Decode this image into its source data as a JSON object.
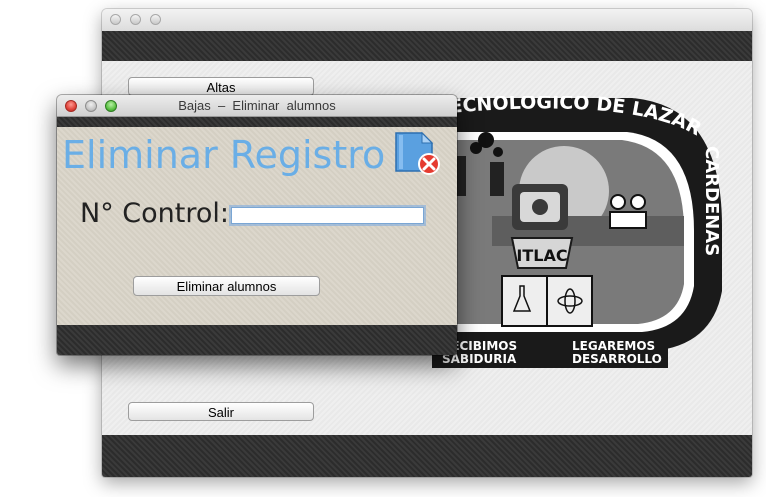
{
  "main_window": {
    "buttons": {
      "altas": "Altas",
      "salir": "Salir"
    }
  },
  "logo": {
    "top_text": "TECNOLOGICO DE LAZARO",
    "side_text": "CARDENAS",
    "center_badge": "ITLAC",
    "motto_left_1": "RECIBIMOS",
    "motto_left_2": "SABIDURIA",
    "motto_right_1": "LEGAREMOS",
    "motto_right_2": "DESARROLLO"
  },
  "dialog": {
    "title": "Bajas  –  Eliminar  alumnos",
    "heading": "Eliminar Registro",
    "field_label": "N° Control:",
    "field_value": "",
    "submit_label": "Eliminar alumnos"
  },
  "colors": {
    "heading": "#6aaee6",
    "close_button": "#e0443b",
    "minimize_button": "#c6c6c6",
    "zoom_button": "#5cc244"
  },
  "icons": {
    "dialog_icon": "file-delete-icon"
  }
}
